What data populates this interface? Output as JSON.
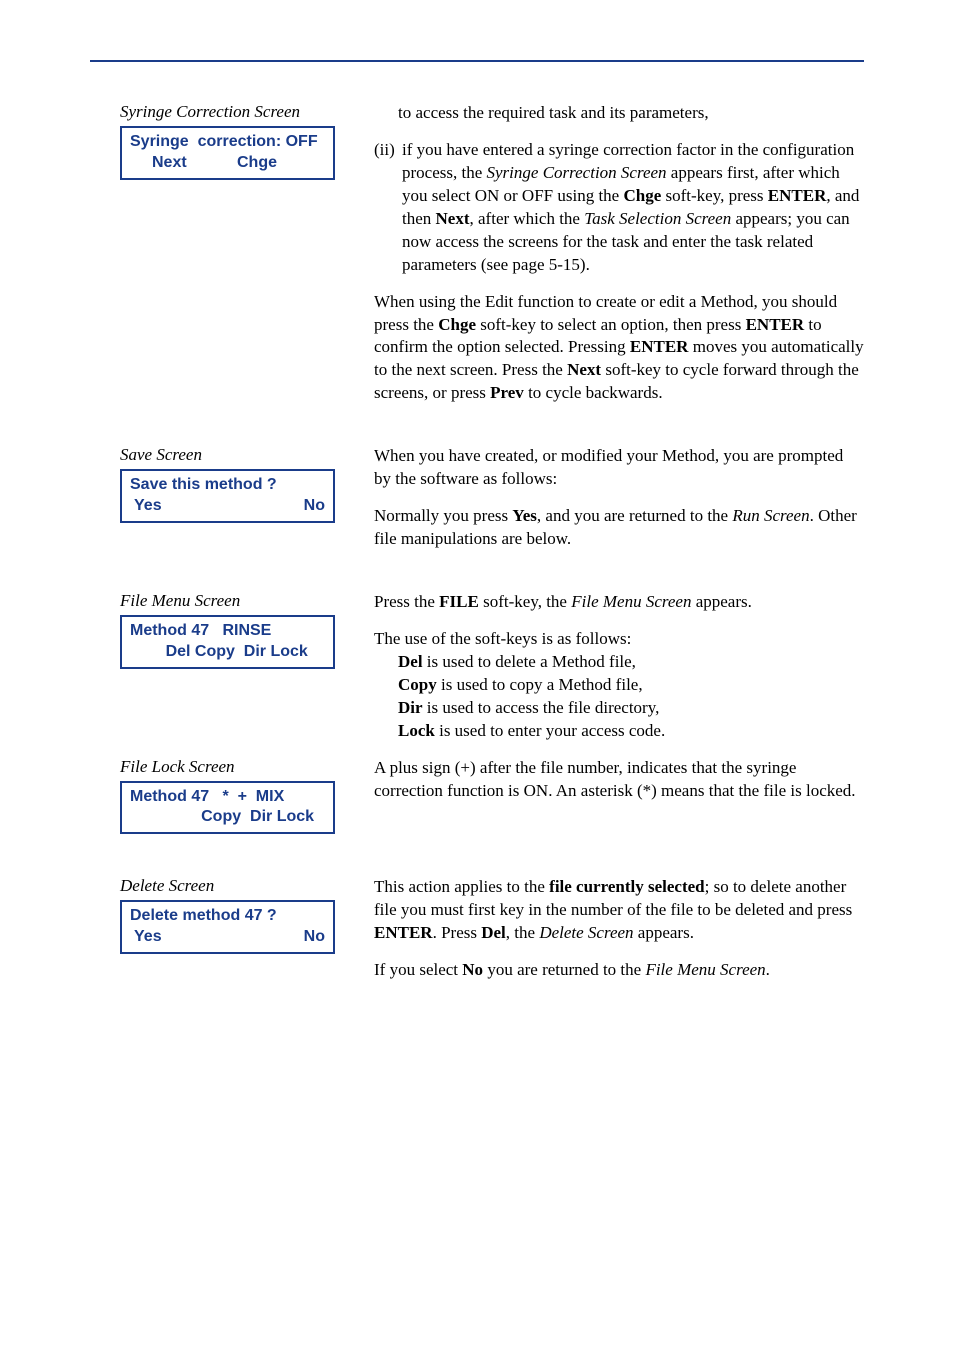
{
  "section1": {
    "caption": "Syringe Correction Screen",
    "lcd_line1": "Syringe  correction: OFF",
    "lcd_line2_left": "Next",
    "lcd_line2_right": "Chge",
    "intro_tail": "to access the required task and its parameters,",
    "ii_marker": "(ii)",
    "ii_body_1": "if you have entered a syringe correction factor in the configuration process, the ",
    "ii_body_2": "Syringe Correction Screen",
    "ii_body_3": " appears first, after which you select ON or OFF using the ",
    "ii_body_4": "Chge",
    "ii_body_5": " soft-key, press ",
    "ii_body_6": "ENTER",
    "ii_body_7": ", and then ",
    "ii_body_8": "Next",
    "ii_body_9": ", after which the ",
    "ii_body_10": "Task Selection Screen",
    "ii_body_11": " appears; you can now access the screens for the task and enter the task related param­eters (see page 5-15).",
    "edit_para_1": "When using the Edit function to create or edit a Method, you should press the ",
    "edit_para_2": "Chge",
    "edit_para_3": " soft-key to select an option, then press ",
    "edit_para_4": "ENTER",
    "edit_para_5": " to confirm the option selected. Pressing ",
    "edit_para_6": "ENTER",
    "edit_para_7": " moves you auto­matically to the next screen. Press the ",
    "edit_para_8": "Next",
    "edit_para_9": " soft-key to cycle forward through the screens, or press ",
    "edit_para_10": "Prev",
    "edit_para_11": " to cycle backwards."
  },
  "section2": {
    "caption": "Save Screen",
    "lcd_line1": "Save this method ?",
    "lcd_line2_left": "Yes",
    "lcd_line2_right": "No",
    "para1": "When you have created, or modified your Method, you are prompted by the software as follows:",
    "para2_a": "Normally you press ",
    "para2_b": "Yes",
    "para2_c": ", and you are returned to the ",
    "para2_d": "Run Screen",
    "para2_e": ". Other file manipulations are below."
  },
  "section3": {
    "caption": "File Menu Screen",
    "lcd_line1": "Method 47   RINSE",
    "lcd_line2": "        Del Copy  Dir Lock",
    "para1_a": "Press the ",
    "para1_b": "FILE",
    "para1_c": " soft-key, the ",
    "para1_d": "File Menu Screen",
    "para1_e": " appears.",
    "para2_intro": "The use of the soft-keys is as follows:",
    "li1_a": "Del",
    "li1_b": " is used to delete a Method file,",
    "li2_a": "Copy",
    "li2_b": " is used to copy a Method file,",
    "li3_a": "Dir",
    "li3_b": " is used to access the file directory,",
    "li4_a": "Lock",
    "li4_b": " is used to enter your access code."
  },
  "section4": {
    "caption": "File Lock Screen",
    "lcd_line1": "Method 47   *  +  MIX",
    "lcd_line2": "                Copy  Dir Lock",
    "para_a": "A plus sign (+) after the file number, indicates that the syringe correction function is ON. An asterisk (*) means that the file is locked."
  },
  "section5": {
    "caption": "Delete Screen",
    "lcd_line1": "Delete method 47 ?",
    "lcd_line2_left": "Yes",
    "lcd_line2_right": "No",
    "para1_a": "This action applies to the ",
    "para1_b": "file currently selected",
    "para1_c": "; so to delete another file you must first key in the number of the file to be deleted and press ",
    "para1_d": "ENTER",
    "para1_e": ". Press ",
    "para1_f": "Del",
    "para1_g": ", the ",
    "para1_h": "Delete Screen",
    "para1_i": " appears.",
    "para2_a": "If you select ",
    "para2_b": "No",
    "para2_c": " you are returned to the ",
    "para2_d": "File Menu Screen",
    "para2_e": "."
  }
}
